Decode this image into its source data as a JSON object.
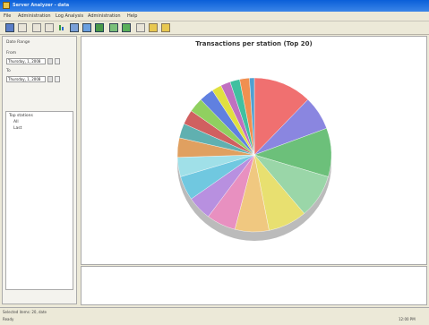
{
  "window": {
    "title": "Server Analyzer - data"
  },
  "menu": [
    "File",
    "Administration",
    "Log Analysis",
    "Administration",
    "Help"
  ],
  "toolbar_icons": [
    "open-icon",
    "save-icon",
    "print-icon",
    "refresh-icon",
    "chart-icon",
    "export-icon",
    "filter-icon",
    "help-icon"
  ],
  "left_panel": {
    "section_label": "Date Range",
    "from_label": "From",
    "from_value": "Thursday, 1, 2008",
    "to_label": "To",
    "to_value": "Thursday, 1, 2008",
    "tree_root": "Top stations",
    "tree_items": [
      "All",
      "Last"
    ]
  },
  "chart": {
    "title": "Transactions per station (Top 20)"
  },
  "chart_data": {
    "type": "pie",
    "title": "Transactions per station (Top 20)",
    "slices": [
      {
        "name": "",
        "value": 12,
        "color": "#f07070"
      },
      {
        "name": "",
        "value": 7,
        "color": "#8a86e0"
      },
      {
        "name": "",
        "value": 10,
        "color": "#6cc07a"
      },
      {
        "name": "",
        "value": 9,
        "color": "#9ad6a8"
      },
      {
        "name": "",
        "value": 8,
        "color": "#e8e070"
      },
      {
        "name": "",
        "value": 7,
        "color": "#f0c880"
      },
      {
        "name": "",
        "value": 6,
        "color": "#e890c0"
      },
      {
        "name": "",
        "value": 5,
        "color": "#b890e0"
      },
      {
        "name": "",
        "value": 5,
        "color": "#70c8e0"
      },
      {
        "name": "",
        "value": 4,
        "color": "#a0e0e8"
      },
      {
        "name": "",
        "value": 4,
        "color": "#e0a060"
      },
      {
        "name": "",
        "value": 3,
        "color": "#60b0b0"
      },
      {
        "name": "",
        "value": 3,
        "color": "#d06060"
      },
      {
        "name": "",
        "value": 3,
        "color": "#90d060"
      },
      {
        "name": "",
        "value": 3,
        "color": "#6080e0"
      },
      {
        "name": "",
        "value": 2,
        "color": "#e0e040"
      },
      {
        "name": "",
        "value": 2,
        "color": "#c070c0"
      },
      {
        "name": "",
        "value": 2,
        "color": "#40c0a0"
      },
      {
        "name": "",
        "value": 2,
        "color": "#f09050"
      },
      {
        "name": "",
        "value": 1,
        "color": "#50a0d0"
      }
    ]
  },
  "status": {
    "left": "Selected items: 20, date",
    "ready": "Ready",
    "right": "12:00 PM"
  }
}
